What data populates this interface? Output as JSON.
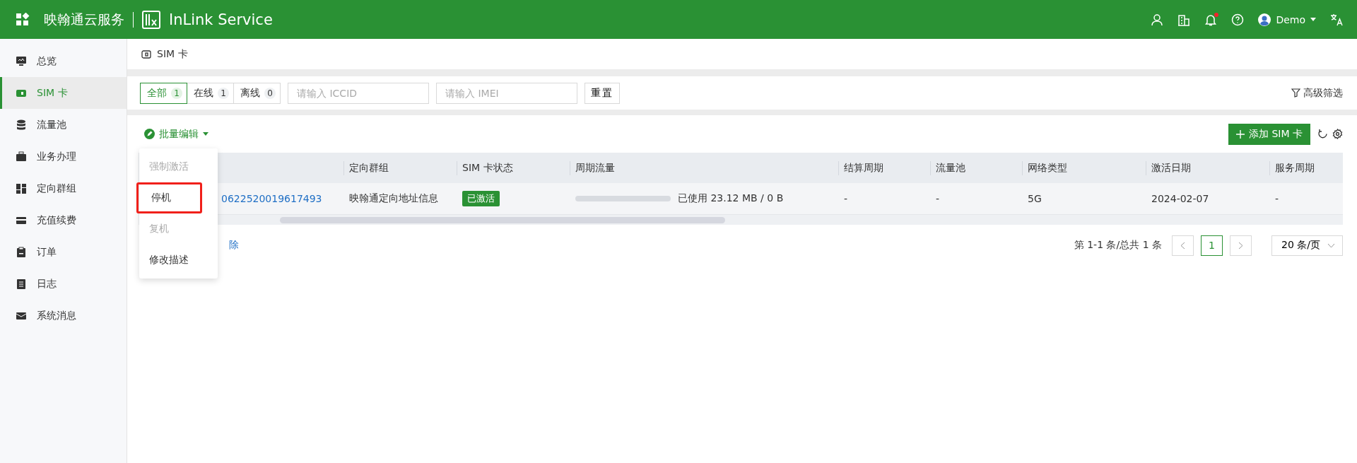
{
  "header": {
    "brand_cn": "映翰通云服务",
    "brand_en": "InLink Service",
    "user": "Demo"
  },
  "sidebar": {
    "items": [
      {
        "label": "总览",
        "selected": false
      },
      {
        "label": "SIM 卡",
        "selected": true
      },
      {
        "label": "流量池",
        "selected": false
      },
      {
        "label": "业务办理",
        "selected": false
      },
      {
        "label": "定向群组",
        "selected": false
      },
      {
        "label": "充值续费",
        "selected": false
      },
      {
        "label": "订单",
        "selected": false
      },
      {
        "label": "日志",
        "selected": false
      },
      {
        "label": "系统消息",
        "selected": false
      }
    ]
  },
  "page": {
    "title": "SIM 卡"
  },
  "filters": {
    "tabs": [
      {
        "label": "全部",
        "count": "1",
        "selected": true
      },
      {
        "label": "在线",
        "count": "1",
        "selected": false
      },
      {
        "label": "离线",
        "count": "0",
        "selected": false
      }
    ],
    "fields": [
      {
        "placeholder": "请输入 ICCID"
      },
      {
        "placeholder": "请输入 IMEI"
      }
    ],
    "reset": "重置",
    "advanced": "高级筛选"
  },
  "toolbar": {
    "batch_edit": "批量编辑",
    "add": "添加 SIM 卡"
  },
  "menu": {
    "items": [
      {
        "label": "强制激活",
        "disabled": true,
        "highlighted": false
      },
      {
        "label": "停机",
        "disabled": false,
        "highlighted": true
      },
      {
        "label": "复机",
        "disabled": true,
        "highlighted": false
      },
      {
        "label": "修改描述",
        "disabled": false,
        "highlighted": false
      }
    ]
  },
  "table": {
    "columns": [
      "定向群组",
      "SIM 卡状态",
      "周期流量",
      "结算周期",
      "流量池",
      "网络类型",
      "激活日期",
      "服务周期"
    ],
    "rows": [
      {
        "iccid": "0622520019617493",
        "group": "映翰通定向地址信息",
        "status": "已激活",
        "usage": "已使用 23.12 MB / 0 B",
        "settlement": "-",
        "pool": "-",
        "network": "5G",
        "activated": "2024-02-07",
        "service": "-"
      }
    ]
  },
  "footer": {
    "delete_link": "除",
    "summary": "第 1-1 条/总共 1 条",
    "page": "1",
    "page_size": "20 条/页"
  }
}
